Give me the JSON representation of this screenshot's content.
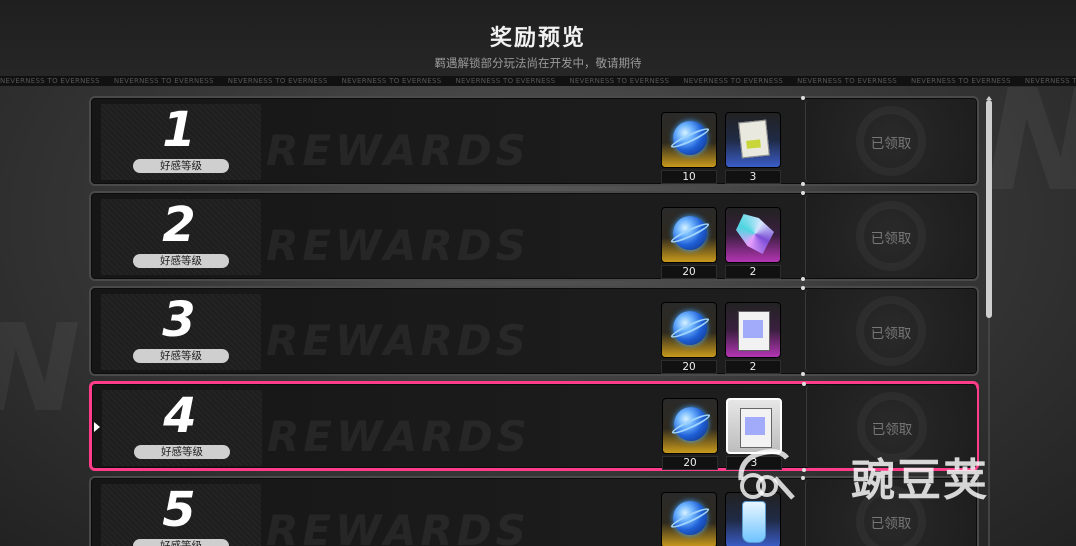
{
  "header": {
    "title": "奖励预览",
    "subtitle": "羁遇解锁部分玩法尚在开发中，敬请期待"
  },
  "ticker_text": "NEVERNESS TO EVERNESS",
  "row_watermark": "REWARDS",
  "rows": [
    {
      "level": "1",
      "level_label": "好感等级",
      "claim": "已领取",
      "items": [
        {
          "icon": "energy-orb-icon",
          "rarity": "gold",
          "count": "10"
        },
        {
          "icon": "card-ticket-icon",
          "rarity": "blue",
          "count": "3"
        }
      ]
    },
    {
      "level": "2",
      "level_label": "好感等级",
      "claim": "已领取",
      "items": [
        {
          "icon": "energy-orb-icon",
          "rarity": "gold",
          "count": "20"
        },
        {
          "icon": "crystal-cluster-icon",
          "rarity": "purple",
          "count": "2"
        }
      ]
    },
    {
      "level": "3",
      "level_label": "好感等级",
      "claim": "已领取",
      "items": [
        {
          "icon": "energy-orb-icon",
          "rarity": "gold",
          "count": "20"
        },
        {
          "icon": "document-icon",
          "rarity": "purple",
          "count": "2"
        }
      ]
    },
    {
      "level": "4",
      "level_label": "好感等级",
      "claim": "已领取",
      "selected": true,
      "items": [
        {
          "icon": "energy-orb-icon",
          "rarity": "gold",
          "count": "20"
        },
        {
          "icon": "document-icon",
          "rarity": "white",
          "count": "3"
        }
      ]
    },
    {
      "level": "5",
      "level_label": "好感等级",
      "claim": "已领取",
      "items": [
        {
          "icon": "energy-orb-icon",
          "rarity": "gold",
          "count": ""
        },
        {
          "icon": "bottle-icon",
          "rarity": "blue",
          "count": ""
        }
      ]
    }
  ],
  "watermark": {
    "text": "豌豆荚"
  },
  "colors": {
    "selected_border": "#ff3d8b",
    "gold": "#c99a1c",
    "blue": "#3a5dc8",
    "purple": "#b335b3"
  }
}
